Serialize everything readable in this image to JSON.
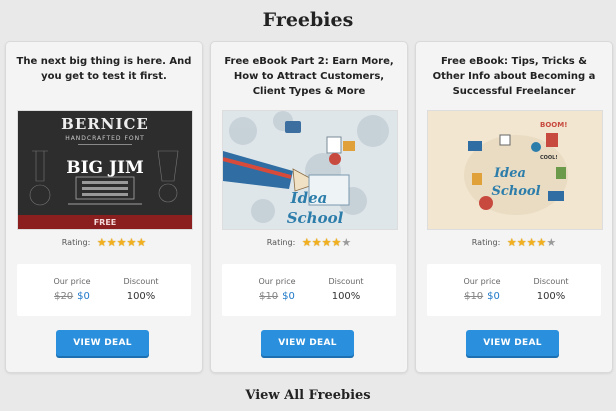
{
  "page": {
    "heading": "Freebies",
    "view_all": "View All Freebies"
  },
  "colors": {
    "button": "#2a8fdc",
    "new_price": "#1e78c8",
    "star_on": "#f2b01e",
    "star_off": "#9a9a9a"
  },
  "cards": [
    {
      "title": "The next big thing is here. And you get to test it first.",
      "image_text": [
        "BERNICE",
        "HANDCRAFTED FONT",
        "BIG JIM",
        "FREE"
      ],
      "rating_label": "Rating:",
      "rating_value": 5,
      "price_label": "Our price",
      "old_price": "$20",
      "new_price": "$0",
      "discount_label": "Discount",
      "discount": "100%",
      "button": "VIEW DEAL"
    },
    {
      "title": "Free eBook Part 2: Earn More, How to Attract Customers, Client Types & More",
      "image_text": [
        "Idea",
        "School"
      ],
      "rating_label": "Rating:",
      "rating_value": 4,
      "price_label": "Our price",
      "old_price": "$10",
      "new_price": "$0",
      "discount_label": "Discount",
      "discount": "100%",
      "button": "VIEW DEAL"
    },
    {
      "title": "Free eBook: Tips, Tricks & Other Info about Becoming a Successful Freelancer",
      "image_text": [
        "BOOM!",
        "Idea",
        "School",
        "COOL!"
      ],
      "rating_label": "Rating:",
      "rating_value": 4,
      "price_label": "Our price",
      "old_price": "$10",
      "new_price": "$0",
      "discount_label": "Discount",
      "discount": "100%",
      "button": "VIEW DEAL"
    }
  ]
}
